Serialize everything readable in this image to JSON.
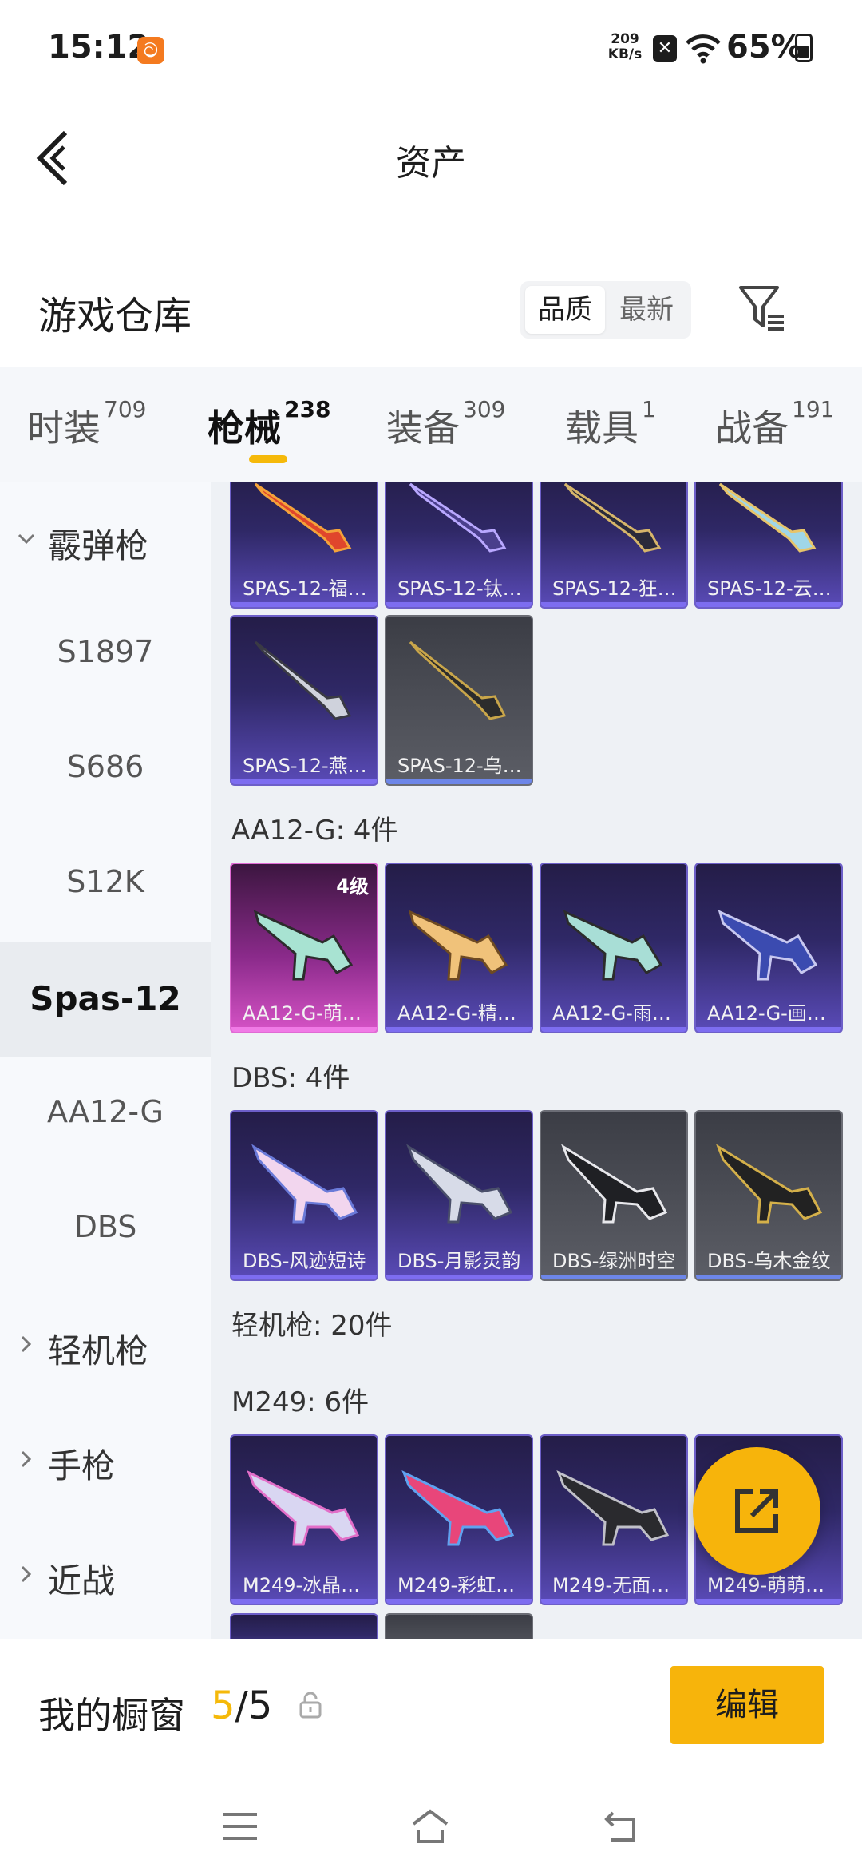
{
  "status_bar": {
    "time": "15:12",
    "app_badge": "ට",
    "net_speed": "209",
    "net_unit": "KB/s",
    "battery": "65%"
  },
  "header": {
    "title": "资产"
  },
  "warehouse": {
    "title": "游戏仓库",
    "sort_quality": "品质",
    "sort_newest": "最新"
  },
  "tabs": [
    {
      "label": "时装",
      "count": "709"
    },
    {
      "label": "枪械",
      "count": "238"
    },
    {
      "label": "装备",
      "count": "309"
    },
    {
      "label": "载具",
      "count": "1"
    },
    {
      "label": "战备",
      "count": "191"
    }
  ],
  "sidebar": [
    {
      "label": "霰弹枪",
      "type": "group-open"
    },
    {
      "label": "S1897",
      "type": "item"
    },
    {
      "label": "S686",
      "type": "item"
    },
    {
      "label": "S12K",
      "type": "item"
    },
    {
      "label": "Spas-12",
      "type": "item",
      "selected": true
    },
    {
      "label": "AA12-G",
      "type": "item"
    },
    {
      "label": "DBS",
      "type": "item"
    },
    {
      "label": "轻机枪",
      "type": "group"
    },
    {
      "label": "手枪",
      "type": "group"
    },
    {
      "label": "近战",
      "type": "group"
    }
  ],
  "content": {
    "spas_row1": [
      "SPAS-12-福…",
      "SPAS-12-钛…",
      "SPAS-12-狂…",
      "SPAS-12-云…"
    ],
    "spas_row2": [
      "SPAS-12-燕…",
      "SPAS-12-乌…"
    ],
    "aa12_title": "AA12-G: 4件",
    "aa12": [
      "AA12-G-萌…",
      "AA12-G-精…",
      "AA12-G-雨…",
      "AA12-G-画…"
    ],
    "aa12_level": "4级",
    "dbs_title": "DBS: 4件",
    "dbs": [
      "DBS-风迹短诗",
      "DBS-月影灵韵",
      "DBS-绿洲时空",
      "DBS-乌木金纹"
    ],
    "lmg_title": "轻机枪: 20件",
    "m249_title": "M249: 6件",
    "m249": [
      "M249-冰晶…",
      "M249-彩虹…",
      "M249-无面…",
      "M249-萌萌…"
    ]
  },
  "showcase": {
    "label": "我的橱窗",
    "current": "5",
    "total": "/5",
    "edit_label": "编辑"
  },
  "colors": {
    "accent": "#f7b40b",
    "purple_card": "#2f2866",
    "grey_card": "#5c5e66",
    "pink_card": "#8a2a8a"
  }
}
